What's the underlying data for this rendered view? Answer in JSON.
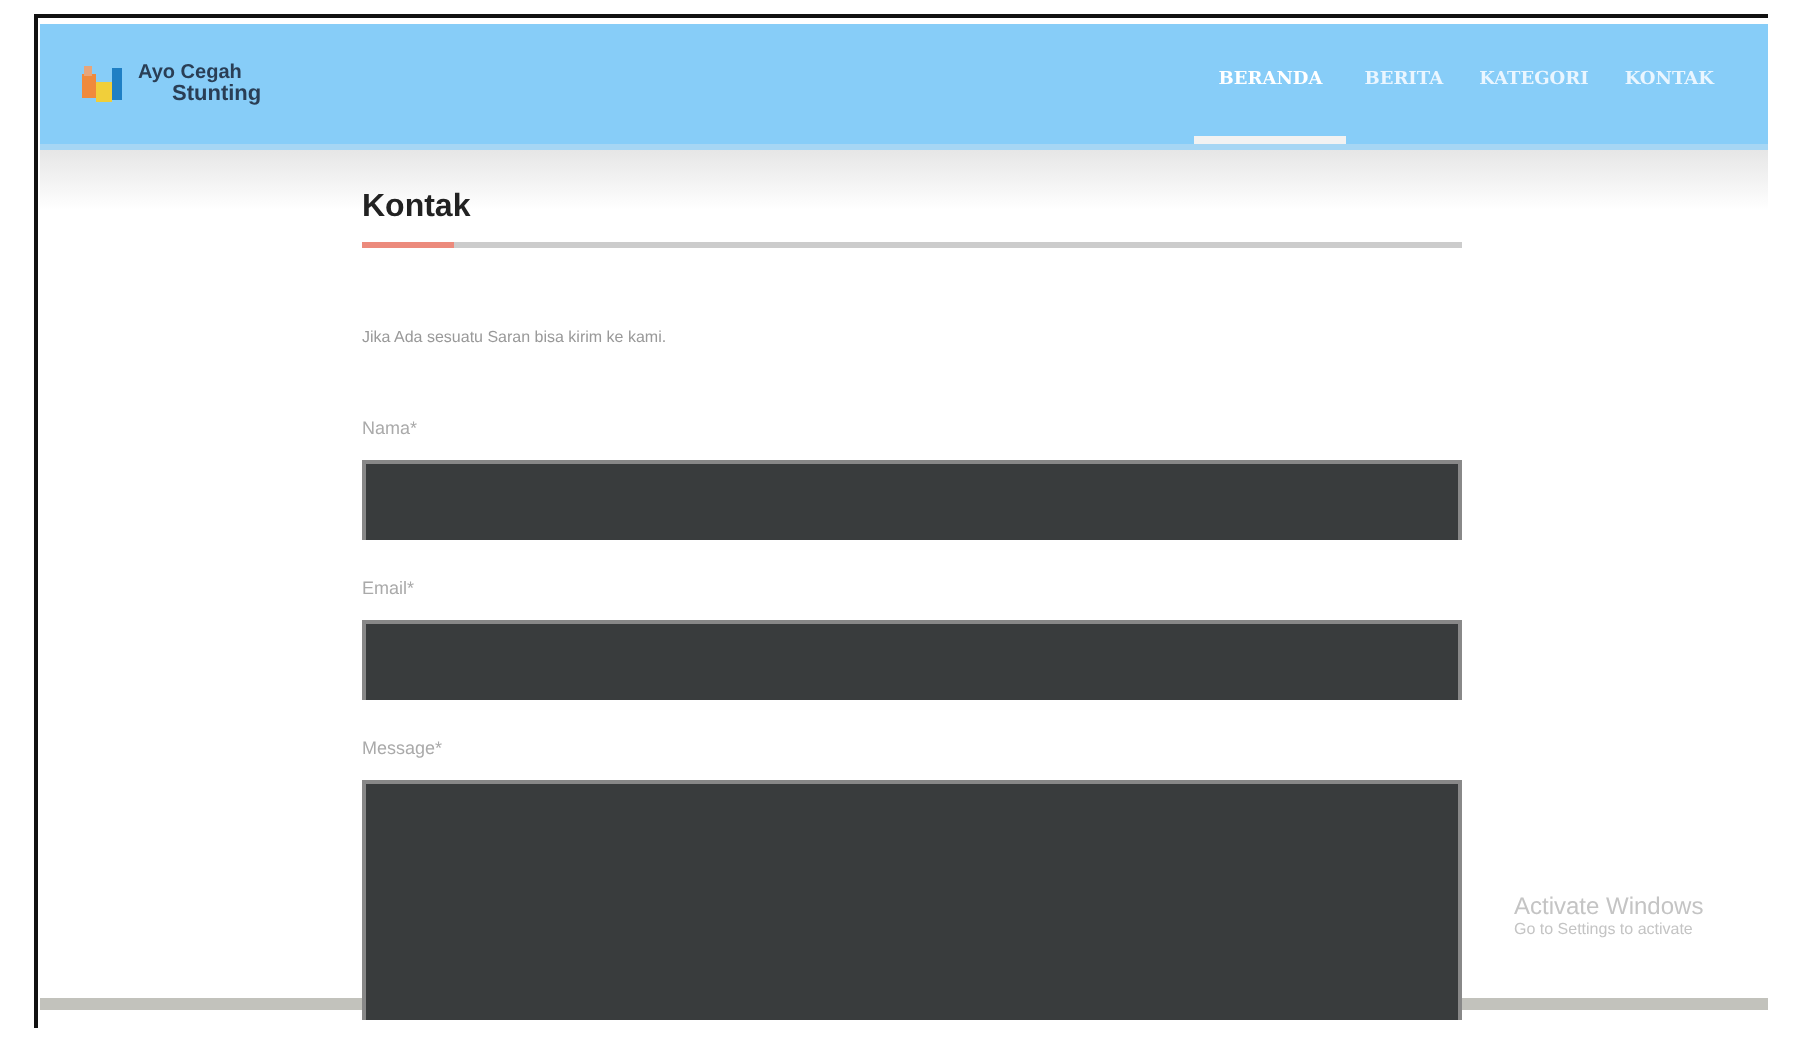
{
  "header": {
    "logo": {
      "line_1": "Ayo Cegah",
      "line_2": "Stunting"
    },
    "nav": [
      {
        "label": "BERANDA",
        "selected": true
      },
      {
        "label": "BERITA",
        "selected": false
      },
      {
        "label": "KATEGORI",
        "selected": false
      },
      {
        "label": "KONTAK",
        "selected": false
      }
    ]
  },
  "page": {
    "title": "Kontak",
    "intro": "Jika Ada sesuatu Saran bisa kirim ke kami.",
    "fields": [
      {
        "label": "Nama*",
        "kind": "input"
      },
      {
        "label": "Email*",
        "kind": "input"
      },
      {
        "label": "Message*",
        "kind": "textarea"
      }
    ]
  },
  "activation_notice": {
    "title": "Activate Windows",
    "subtitle": "Go to Settings to activate"
  }
}
